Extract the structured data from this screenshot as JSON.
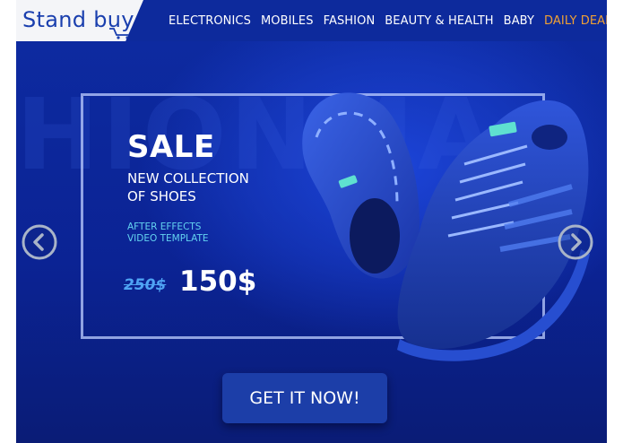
{
  "header": {
    "logo": "Stand buy",
    "nav": [
      {
        "label": "ELECTRONICS"
      },
      {
        "label": "MOBILES"
      },
      {
        "label": "FASHION"
      },
      {
        "label": "BEAUTY & HEALTH"
      },
      {
        "label": "BABY"
      },
      {
        "label": "DAILY DEALS"
      }
    ]
  },
  "hero": {
    "background_word": "HIONMA",
    "title": "SALE",
    "subtitle_line1": "NEW COLLECTION",
    "subtitle_line2": "OF SHOES",
    "tagline_line1": "AFTER EFFECTS",
    "tagline_line2": "VIDEO TEMPLATE",
    "old_price": "250$",
    "new_price": "150$",
    "cta_label": "GET IT NOW!"
  },
  "colors": {
    "header_bg": "#0d2a9c",
    "hero_bg": "#0b2394",
    "accent_orange": "#f0a034",
    "tagline_cyan": "#63d2f0",
    "old_price_blue": "#4fa4f4",
    "cta_bg": "#1c3ea8"
  },
  "icons": [
    "shopping-cart-icon",
    "chevron-left-icon",
    "chevron-right-icon"
  ]
}
